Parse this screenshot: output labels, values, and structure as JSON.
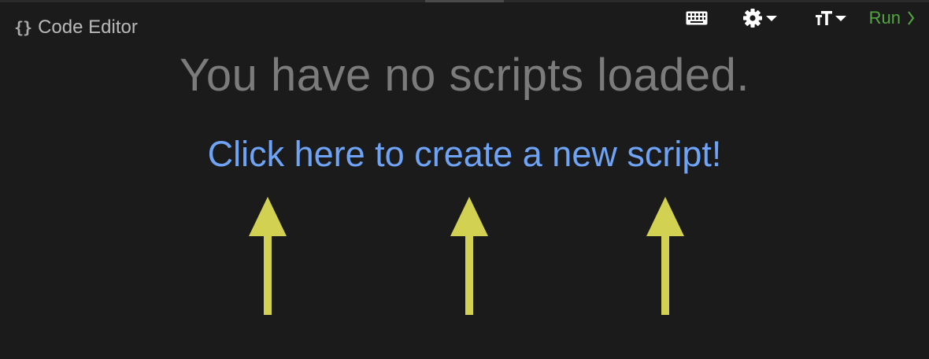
{
  "editor": {
    "braces": "{}",
    "title": "Code Editor"
  },
  "toolbar": {
    "keyboard_icon": "keyboard-icon",
    "settings_icon": "gear-icon",
    "font_icon": "font-size-icon",
    "run_label": "Run",
    "run_icon": "chevron-right-icon",
    "run_color": "#52a83f"
  },
  "main": {
    "empty_message": "You have no scripts loaded.",
    "create_link": "Click here to create a new script!",
    "link_color": "#6ea3f5",
    "arrow_color": "#d2d152",
    "arrows": [
      "arrow-up-icon",
      "arrow-up-icon",
      "arrow-up-icon"
    ]
  }
}
